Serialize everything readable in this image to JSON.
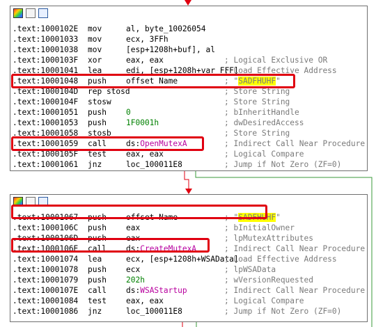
{
  "colors": {
    "accent_red": "#e00010",
    "edge_red": "#e00010",
    "edge_green": "#3a9a3a",
    "string_highlight": "#ffff00",
    "comment_gray": "#7a7a7a",
    "number_green": "#008000",
    "ref_magenta": "#b8009e"
  },
  "block1": {
    "icons": [
      "graph-color-icon",
      "edit-pencil-icon",
      "image-thumbnail-icon"
    ],
    "lines": [
      {
        "addr": ".text:1000102E",
        "mn": "mov",
        "op": "al, byte_10026054",
        "cm": ""
      },
      {
        "addr": ".text:10001033",
        "mn": "mov",
        "op": "ecx, 3FFh",
        "cm": ""
      },
      {
        "addr": ".text:10001038",
        "mn": "mov",
        "op": "[esp+1208h+buf], al",
        "cm": ""
      },
      {
        "addr": ".text:1000103F",
        "mn": "xor",
        "op": "eax, eax",
        "cm": "; Logical Exclusive OR"
      },
      {
        "addr": ".text:10001041",
        "mn": "lea",
        "op": "edi, [esp+1208h+var_FFF]",
        "cm": "; Load Effective Address"
      },
      {
        "addr": ".text:10001048",
        "mn": "push",
        "op": "offset Name",
        "cm_pre": "; \"",
        "cm_hl": "SADFHUHF",
        "cm_post": "\""
      },
      {
        "addr": ".text:1000104D",
        "mn": "rep stosd",
        "op": "",
        "cm": "; Store String"
      },
      {
        "addr": ".text:1000104F",
        "mn": "stosw",
        "op": "",
        "cm": "; Store String"
      },
      {
        "addr": ".text:10001051",
        "mn": "push",
        "op": "0",
        "cm": "; bInheritHandle"
      },
      {
        "addr": ".text:10001053",
        "mn": "push",
        "op": "1F0001h",
        "cm": "; dwDesiredAccess"
      },
      {
        "addr": ".text:10001058",
        "mn": "stosb",
        "op": "",
        "cm": "; Store String"
      },
      {
        "addr": ".text:10001059",
        "mn": "call",
        "op_pre": "ds:",
        "op_ref": "OpenMutexA",
        "cm": "; Indirect Call Near Procedure"
      },
      {
        "addr": ".text:1000105F",
        "mn": "test",
        "op": "eax, eax",
        "cm": "; Logical Compare"
      },
      {
        "addr": ".text:10001061",
        "mn": "jnz",
        "op": "loc_100011E8",
        "cm": "; Jump if Not Zero (ZF=0)"
      }
    ]
  },
  "block2": {
    "icons": [
      "graph-color-icon",
      "edit-pencil-icon",
      "image-thumbnail-icon"
    ],
    "lines": [
      {
        "addr": ".text:10001067",
        "mn": "push",
        "op": "offset Name",
        "cm_pre": "; \"",
        "cm_hl": "SADFHUHF",
        "cm_post": "\""
      },
      {
        "addr": ".text:1000106C",
        "mn": "push",
        "op": "eax",
        "cm": "; bInitialOwner"
      },
      {
        "addr": ".text:1000106D",
        "mn": "push",
        "op": "eax",
        "cm": "; lpMutexAttributes"
      },
      {
        "addr": ".text:1000106E",
        "mn": "call",
        "op_pre": "ds:",
        "op_ref": "CreateMutexA",
        "cm": "; Indirect Call Near Procedure"
      },
      {
        "addr": ".text:10001074",
        "mn": "lea",
        "op": "ecx, [esp+1208h+WSAData]",
        "cm": "; Load Effective Address"
      },
      {
        "addr": ".text:10001078",
        "mn": "push",
        "op": "ecx",
        "cm": "; lpWSAData"
      },
      {
        "addr": ".text:10001079",
        "mn": "push",
        "op": "202h",
        "cm": "; wVersionRequested"
      },
      {
        "addr": ".text:1000107E",
        "mn": "call",
        "op_pre": "ds:",
        "op_ref": "WSAStartup",
        "cm": "; Indirect Call Near Procedure"
      },
      {
        "addr": ".text:10001084",
        "mn": "test",
        "op": "eax, eax",
        "cm": "; Logical Compare"
      },
      {
        "addr": ".text:10001086",
        "mn": "jnz",
        "op": "loc_100011E8",
        "cm": "; Jump if Not Zero (ZF=0)"
      }
    ]
  }
}
